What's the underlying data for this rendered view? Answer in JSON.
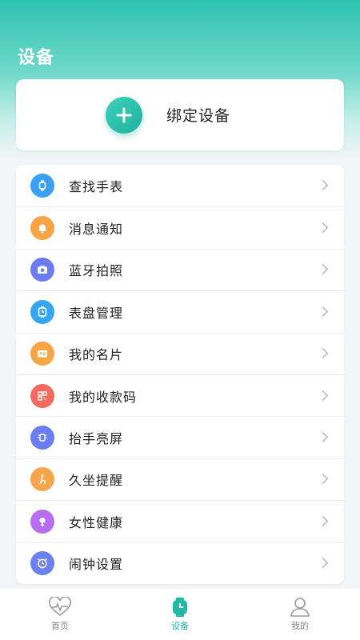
{
  "header": {
    "title": "设备"
  },
  "bind": {
    "label": "绑定设备"
  },
  "menu": {
    "items": [
      {
        "label": "查找手表",
        "icon": "watch-icon",
        "color": "#3aa0f3"
      },
      {
        "label": "消息通知",
        "icon": "bell-icon",
        "color": "#f7a445"
      },
      {
        "label": "蓝牙拍照",
        "icon": "camera-icon",
        "color": "#6c7cf0"
      },
      {
        "label": "表盘管理",
        "icon": "watch-face-icon",
        "color": "#36a6f2"
      },
      {
        "label": "我的名片",
        "icon": "card-icon",
        "color": "#f6a647"
      },
      {
        "label": "我的收款码",
        "icon": "qr-code-icon",
        "color": "#f36b5f"
      },
      {
        "label": "抬手亮屏",
        "icon": "raise-wrist-icon",
        "color": "#6b7ef0"
      },
      {
        "label": "久坐提醒",
        "icon": "sitting-icon",
        "color": "#f7a54a"
      },
      {
        "label": "女性健康",
        "icon": "female-health-icon",
        "color": "#b86ef0"
      },
      {
        "label": "闹钟设置",
        "icon": "alarm-icon",
        "color": "#6c80f0"
      }
    ]
  },
  "tabs": [
    {
      "label": "首页",
      "icon": "heart-pulse-icon",
      "active": false
    },
    {
      "label": "设备",
      "icon": "device-watch-icon",
      "active": true
    },
    {
      "label": "我的",
      "icon": "user-icon",
      "active": false
    }
  ],
  "colors": {
    "accent": "#21b8a4",
    "header_gradient_top": "#2ec3b0"
  }
}
